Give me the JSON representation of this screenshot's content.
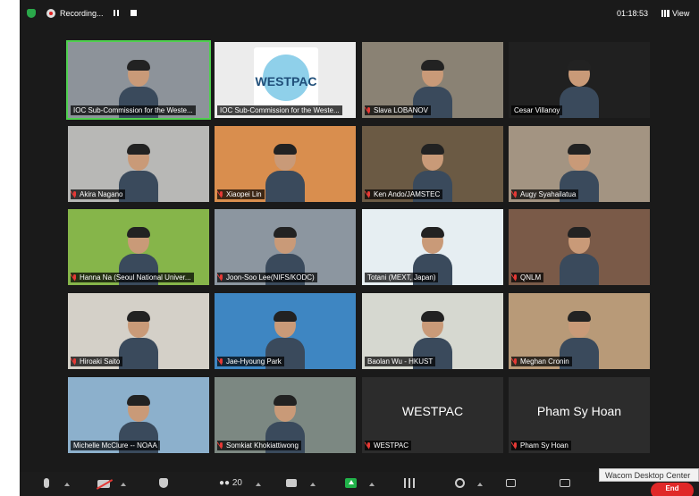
{
  "topbar": {
    "recording_label": "Recording...",
    "clock": "01:18:53",
    "view_label": "View"
  },
  "tiles": [
    {
      "name": "IOC Sub-Commission for the Weste...",
      "bg": "#8d939a",
      "muted": false,
      "type": "video",
      "active": true
    },
    {
      "name": "IOC Sub-Commission for the Weste...",
      "bg": "#ececec",
      "muted": false,
      "type": "logo",
      "logo_text": "WESTPAC"
    },
    {
      "name": "Slava LOBANOV",
      "bg": "#8a8274",
      "muted": true,
      "type": "video"
    },
    {
      "name": "Cesar Villanoy",
      "bg": "#202020",
      "muted": false,
      "type": "video"
    },
    {
      "name": "Akira Nagano",
      "bg": "#b8b8b6",
      "muted": true,
      "type": "video"
    },
    {
      "name": "Xiaopei Lin",
      "bg": "#d98e4e",
      "muted": true,
      "type": "video"
    },
    {
      "name": "Ken Ando/JAMSTEC",
      "bg": "#6b5a44",
      "muted": true,
      "type": "video"
    },
    {
      "name": "Augy Syahailatua",
      "bg": "#a39482",
      "muted": true,
      "type": "video"
    },
    {
      "name": "Hanna Na (Seoul National Univer...",
      "bg": "#86b54a",
      "muted": true,
      "type": "video"
    },
    {
      "name": "Joon-Soo Lee(NIFS/KODC)",
      "bg": "#8c96a0",
      "muted": true,
      "type": "video"
    },
    {
      "name": "Totani (MEXT, Japan)",
      "bg": "#e6eef2",
      "muted": false,
      "type": "video"
    },
    {
      "name": "QNLM",
      "bg": "#7a5a48",
      "muted": true,
      "type": "video"
    },
    {
      "name": "Hiroaki Saito",
      "bg": "#d4d0c8",
      "muted": true,
      "type": "video"
    },
    {
      "name": "Jae-Hyoung Park",
      "bg": "#3e86c2",
      "muted": true,
      "type": "video"
    },
    {
      "name": "Baolan Wu - HKUST",
      "bg": "#d6d8d0",
      "muted": false,
      "type": "video"
    },
    {
      "name": "Meghan Cronin",
      "bg": "#b89a78",
      "muted": true,
      "type": "video"
    },
    {
      "name": "Michelle McClure -- NOAA",
      "bg": "#8cb0cc",
      "muted": false,
      "type": "video"
    },
    {
      "name": "Somkiat Khokiattiwong",
      "bg": "#7c8882",
      "muted": true,
      "type": "video"
    },
    {
      "name": "WESTPAC",
      "bg": "#2c2c2c",
      "muted": true,
      "type": "text",
      "big": "WESTPAC"
    },
    {
      "name": "Pham Sy Hoan",
      "bg": "#2c2c2c",
      "muted": true,
      "type": "text",
      "big": "Pham Sy Hoan"
    }
  ],
  "toolbar": {
    "participants_count": "20",
    "more": "•••"
  },
  "tooltip": "Wacom Desktop Center",
  "end_label": "End"
}
